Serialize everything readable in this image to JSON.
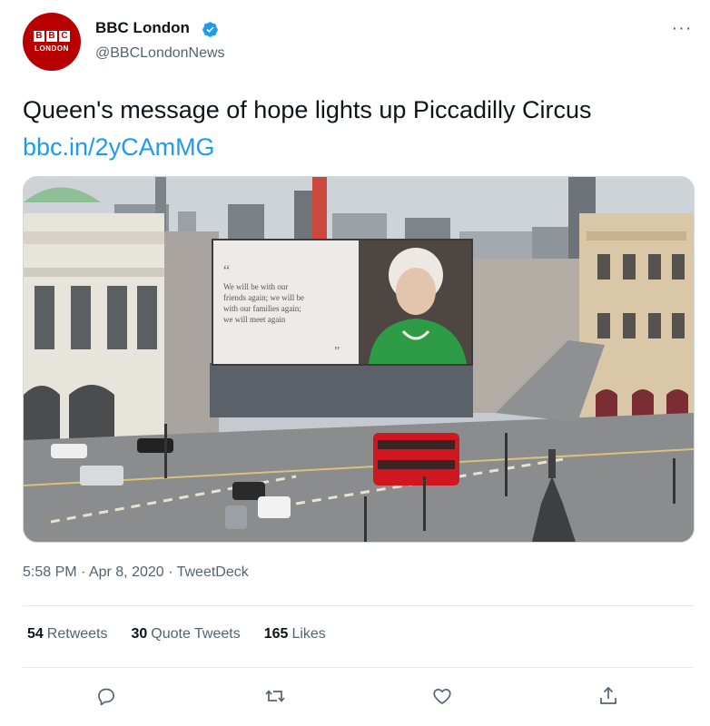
{
  "author": {
    "avatar_letters": [
      "B",
      "B",
      "C"
    ],
    "avatar_sub": "LONDON",
    "display_name": "BBC London",
    "handle": "@BBCLondonNews",
    "verified": true
  },
  "tweet": {
    "text": "Queen's message of hope lights up Piccadilly Circus",
    "link": "bbc.in/2yCAmMG",
    "billboard_quote": [
      "We will be with our",
      "friends again; we will be",
      "with our families again;",
      "we will meet again"
    ],
    "timestamp_time": "5:58 PM",
    "timestamp_sep1": " · ",
    "timestamp_date": "Apr 8, 2020",
    "timestamp_sep2": " · ",
    "source": "TweetDeck"
  },
  "stats": {
    "retweets_count": "54",
    "retweets_label": "Retweets",
    "quotes_count": "30",
    "quotes_label": "Quote Tweets",
    "likes_count": "165",
    "likes_label": "Likes"
  },
  "icons": {
    "more": "more-icon",
    "reply": "reply-icon",
    "retweet": "retweet-icon",
    "like": "like-icon",
    "share": "share-icon",
    "verified": "verified-badge-icon"
  },
  "colors": {
    "link": "#1d9bf0",
    "avatar_bg": "#b80000",
    "verified": "#1d9bf0",
    "secondary_text": "#536471",
    "bus_red": "#d0171f",
    "dress_green": "#2e9b46"
  }
}
